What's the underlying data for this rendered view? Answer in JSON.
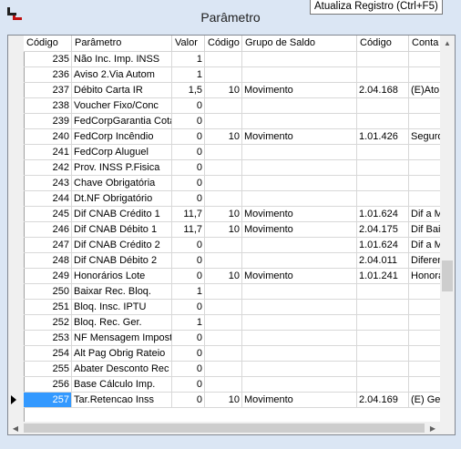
{
  "window": {
    "title": "Parâmetro"
  },
  "tooltip": {
    "text": "Atualiza Registro (Ctrl+F5)"
  },
  "grid": {
    "columns": [
      "Código",
      "Parâmetro",
      "Valor",
      "Código",
      "Grupo de Saldo",
      "Código",
      "Conta"
    ],
    "rows": [
      [
        "235",
        "Não Inc. Imp. INSS",
        "1",
        "",
        "",
        "",
        ""
      ],
      [
        "236",
        "Aviso 2.Via Autom",
        "1",
        "",
        "",
        "",
        ""
      ],
      [
        "237",
        "Débito Carta IR",
        "1,5",
        "10",
        "Movimento",
        "2.04.168",
        "(E)Ato D"
      ],
      [
        "238",
        "Voucher Fixo/Conc",
        "0",
        "",
        "",
        "",
        ""
      ],
      [
        "239",
        "FedCorpGarantia Cota",
        "0",
        "",
        "",
        "",
        ""
      ],
      [
        "240",
        "FedCorp Incêndio",
        "0",
        "10",
        "Movimento",
        "1.01.426",
        "Seguro I"
      ],
      [
        "241",
        "FedCorp Aluguel",
        "0",
        "",
        "",
        "",
        ""
      ],
      [
        "242",
        "Prov. INSS P.Fisica",
        "0",
        "",
        "",
        "",
        ""
      ],
      [
        "243",
        "Chave Obrigatória",
        "0",
        "",
        "",
        "",
        ""
      ],
      [
        "244",
        "Dt.NF Obrigatório",
        "0",
        "",
        "",
        "",
        ""
      ],
      [
        "245",
        "Dif CNAB Crédito 1",
        "11,7",
        "10",
        "Movimento",
        "1.01.624",
        "Dif a Ma"
      ],
      [
        "246",
        "Dif CNAB Débito 1",
        "11,7",
        "10",
        "Movimento",
        "2.04.175",
        "Dif Baixa"
      ],
      [
        "247",
        "Dif CNAB Crédito 2",
        "0",
        "",
        "",
        "1.01.624",
        "Dif a Ma"
      ],
      [
        "248",
        "Dif CNAB Débito 2",
        "0",
        "",
        "",
        "2.04.011",
        "Diferenç"
      ],
      [
        "249",
        "Honorários Lote",
        "0",
        "10",
        "Movimento",
        "1.01.241",
        "Honorári"
      ],
      [
        "250",
        "Baixar Rec. Bloq.",
        "1",
        "",
        "",
        "",
        ""
      ],
      [
        "251",
        "Bloq. Insc. IPTU",
        "0",
        "",
        "",
        "",
        ""
      ],
      [
        "252",
        "Bloq. Rec. Ger.",
        "1",
        "",
        "",
        "",
        ""
      ],
      [
        "253",
        "NF Mensagem Imposto",
        "0",
        "",
        "",
        "",
        ""
      ],
      [
        "254",
        "Alt Pag Obrig Rateio",
        "0",
        "",
        "",
        "",
        ""
      ],
      [
        "255",
        "Abater Desconto Rec",
        "0",
        "",
        "",
        "",
        ""
      ],
      [
        "256",
        "Base Cálculo Imp.",
        "0",
        "",
        "",
        "",
        ""
      ],
      [
        "257",
        "Tar.Retencao Inss",
        "0",
        "10",
        "Movimento",
        "2.04.169",
        "(E) Gest"
      ]
    ],
    "current_row": "257"
  }
}
